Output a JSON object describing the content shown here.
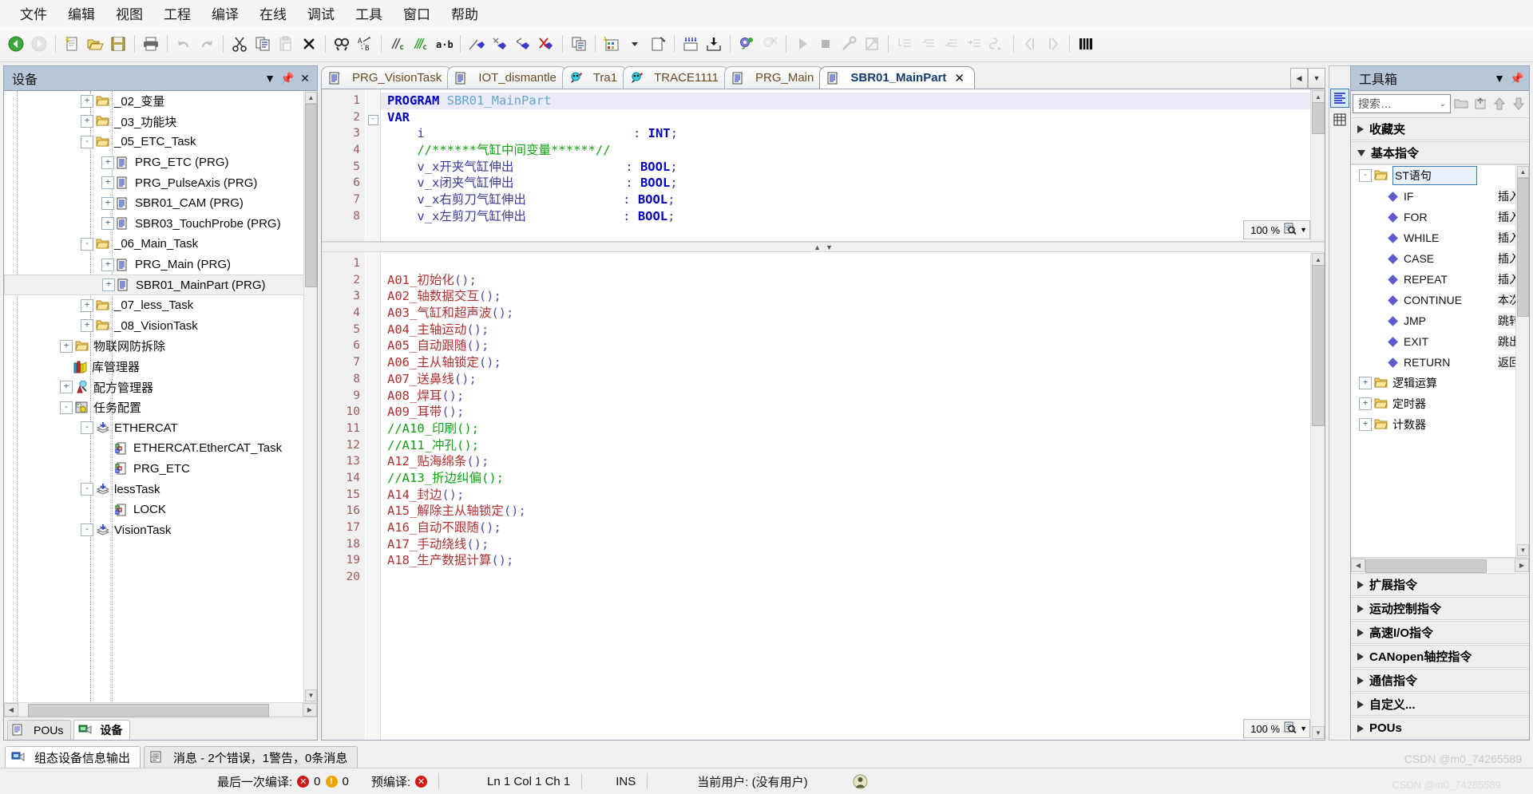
{
  "menu": {
    "items": [
      "文件",
      "编辑",
      "视图",
      "工程",
      "编译",
      "在线",
      "调试",
      "工具",
      "窗口",
      "帮助"
    ]
  },
  "toolbar": {
    "icons": [
      "back-icon",
      "forward-icon",
      "sep",
      "new-file-icon",
      "open-folder-icon",
      "save-icon",
      "sep",
      "print-icon",
      "sep",
      "undo-icon",
      "redo-icon",
      "sep",
      "cut-icon",
      "copy-icon",
      "paste-icon",
      "delete-icon",
      "sep",
      "find-icon",
      "replace-icon",
      "sep",
      "compile-icon",
      "rebuild-icon",
      "a-b-icon",
      "sep",
      "login-icon",
      "download-icon",
      "upload-icon",
      "logout-icon",
      "sep",
      "copy-all-icon",
      "sep",
      "visualization-icon",
      "dropdown-icon",
      "new-window-icon",
      "sep",
      "write-values-icon",
      "force-values-icon",
      "sep",
      "start-debug-icon",
      "stop-debug-icon",
      "sep",
      "run-icon",
      "stop-icon",
      "wrench-icon",
      "edit-mode-icon",
      "sep",
      "indent1-icon",
      "indent2-icon",
      "indent3-icon",
      "indent4-icon",
      "jump-icon",
      "sep",
      "prev-icon",
      "next-icon",
      "sep",
      "grid-icon"
    ]
  },
  "devices": {
    "title": "设备",
    "caption_buttons": [
      "chevron-down-icon",
      "pin-icon",
      "close-icon"
    ],
    "tree": [
      {
        "label": "_02_变量",
        "indent": 3,
        "expander": "+",
        "icon": "folder-icon",
        "selected": false
      },
      {
        "label": "_03_功能块",
        "indent": 3,
        "expander": "+",
        "icon": "folder-icon",
        "selected": false
      },
      {
        "label": "_05_ETC_Task",
        "indent": 3,
        "expander": "-",
        "icon": "folder-icon",
        "selected": false
      },
      {
        "label": "PRG_ETC (PRG)",
        "indent": 4,
        "expander": "+",
        "icon": "pou-icon",
        "selected": false
      },
      {
        "label": "PRG_PulseAxis (PRG)",
        "indent": 4,
        "expander": "+",
        "icon": "pou-icon",
        "selected": false
      },
      {
        "label": "SBR01_CAM (PRG)",
        "indent": 4,
        "expander": "+",
        "icon": "pou-icon",
        "selected": false
      },
      {
        "label": "SBR03_TouchProbe (PRG)",
        "indent": 4,
        "expander": "+",
        "icon": "pou-icon",
        "selected": false
      },
      {
        "label": "_06_Main_Task",
        "indent": 3,
        "expander": "-",
        "icon": "folder-icon",
        "selected": false
      },
      {
        "label": "PRG_Main (PRG)",
        "indent": 4,
        "expander": "+",
        "icon": "pou-icon",
        "selected": false
      },
      {
        "label": "SBR01_MainPart (PRG)",
        "indent": 4,
        "expander": "+",
        "icon": "pou-icon",
        "selected": true
      },
      {
        "label": "_07_less_Task",
        "indent": 3,
        "expander": "+",
        "icon": "folder-icon",
        "selected": false
      },
      {
        "label": "_08_VisionTask",
        "indent": 3,
        "expander": "+",
        "icon": "folder-icon",
        "selected": false
      },
      {
        "label": "物联网防拆除",
        "indent": 2,
        "expander": "+",
        "icon": "folder-icon",
        "selected": false
      },
      {
        "label": "库管理器",
        "indent": 2,
        "expander": "",
        "icon": "library-icon",
        "selected": false
      },
      {
        "label": "配方管理器",
        "indent": 2,
        "expander": "+",
        "icon": "recipe-icon",
        "selected": false
      },
      {
        "label": "任务配置",
        "indent": 2,
        "expander": "-",
        "icon": "taskconfig-icon",
        "selected": false
      },
      {
        "label": "ETHERCAT",
        "indent": 3,
        "expander": "-",
        "icon": "task-icon",
        "selected": false
      },
      {
        "label": "ETHERCAT.EtherCAT_Task",
        "indent": 4,
        "expander": "",
        "icon": "taskcall-icon",
        "selected": false
      },
      {
        "label": "PRG_ETC",
        "indent": 4,
        "expander": "",
        "icon": "taskcall-icon",
        "selected": false
      },
      {
        "label": "lessTask",
        "indent": 3,
        "expander": "-",
        "icon": "task-icon",
        "selected": false
      },
      {
        "label": "LOCK",
        "indent": 4,
        "expander": "",
        "icon": "taskcall-icon",
        "selected": false
      },
      {
        "label": "VisionTask",
        "indent": 3,
        "expander": "-",
        "icon": "task-icon",
        "selected": false
      }
    ],
    "bottom_tabs": [
      {
        "label": "POUs",
        "icon": "pous-icon",
        "active": false
      },
      {
        "label": "设备",
        "icon": "devices-icon",
        "active": true
      }
    ]
  },
  "editor": {
    "tabs": [
      {
        "label": "PRG_VisionTask",
        "icon": "pou-icon",
        "active": false,
        "closable": false
      },
      {
        "label": "IOT_dismantle",
        "icon": "pou-icon",
        "active": false,
        "closable": false
      },
      {
        "label": "Tra1",
        "icon": "trace-icon",
        "active": false,
        "closable": false
      },
      {
        "label": "TRACE1111",
        "icon": "trace-icon",
        "active": false,
        "closable": false
      },
      {
        "label": "PRG_Main",
        "icon": "pou-icon",
        "active": false,
        "closable": false
      },
      {
        "label": "SBR01_MainPart",
        "icon": "pou-icon",
        "active": true,
        "closable": true
      }
    ],
    "tab_nav": [
      "chevron-left-icon",
      "chevron-down-icon"
    ],
    "declaration": {
      "zoom": "100 %",
      "lines": [
        {
          "n": 1,
          "fold": "",
          "current": true,
          "segs": [
            {
              "t": "PROGRAM ",
              "c": "kw"
            },
            {
              "t": "SBR01_MainPart",
              "c": "idn"
            }
          ]
        },
        {
          "n": 2,
          "fold": "-",
          "current": false,
          "segs": [
            {
              "t": "VAR",
              "c": "kw"
            }
          ]
        },
        {
          "n": 3,
          "fold": "",
          "current": false,
          "segs": [
            {
              "t": "    i                            : ",
              "c": "var"
            },
            {
              "t": "INT",
              "c": "typ"
            },
            {
              "t": ";",
              "c": "var"
            }
          ]
        },
        {
          "n": 4,
          "fold": "",
          "current": false,
          "segs": [
            {
              "t": "    //******气缸中间变量******//",
              "c": "cmt"
            }
          ]
        },
        {
          "n": 5,
          "fold": "",
          "current": false,
          "segs": [
            {
              "t": "    v_x开夹气缸伸出               : ",
              "c": "var"
            },
            {
              "t": "BOOL",
              "c": "typ"
            },
            {
              "t": ";",
              "c": "var"
            }
          ]
        },
        {
          "n": 6,
          "fold": "",
          "current": false,
          "segs": [
            {
              "t": "    v_x闭夹气缸伸出               : ",
              "c": "var"
            },
            {
              "t": "BOOL",
              "c": "typ"
            },
            {
              "t": ";",
              "c": "var"
            }
          ]
        },
        {
          "n": 7,
          "fold": "",
          "current": false,
          "segs": [
            {
              "t": "    v_x右剪刀气缸伸出             : ",
              "c": "var"
            },
            {
              "t": "BOOL",
              "c": "typ"
            },
            {
              "t": ";",
              "c": "var"
            }
          ]
        },
        {
          "n": 8,
          "fold": "",
          "current": false,
          "segs": [
            {
              "t": "    v_x左剪刀气缸伸出             : ",
              "c": "var"
            },
            {
              "t": "BOOL",
              "c": "typ"
            },
            {
              "t": ";",
              "c": "var"
            }
          ]
        }
      ]
    },
    "implementation": {
      "zoom": "100 %",
      "lines": [
        {
          "n": 1,
          "segs": []
        },
        {
          "n": 2,
          "segs": [
            {
              "t": "A01_初始化",
              "c": "fn"
            },
            {
              "t": "();",
              "c": "pn"
            }
          ]
        },
        {
          "n": 3,
          "segs": [
            {
              "t": "A02_轴数据交互",
              "c": "fn"
            },
            {
              "t": "();",
              "c": "pn"
            }
          ]
        },
        {
          "n": 4,
          "segs": [
            {
              "t": "A03_气缸和超声波",
              "c": "fn"
            },
            {
              "t": "();",
              "c": "pn"
            }
          ]
        },
        {
          "n": 5,
          "segs": [
            {
              "t": "A04_主轴运动",
              "c": "fn"
            },
            {
              "t": "();",
              "c": "pn"
            }
          ]
        },
        {
          "n": 6,
          "segs": [
            {
              "t": "A05_自动跟随",
              "c": "fn"
            },
            {
              "t": "();",
              "c": "pn"
            }
          ]
        },
        {
          "n": 7,
          "segs": [
            {
              "t": "A06_主从轴锁定",
              "c": "fn"
            },
            {
              "t": "();",
              "c": "pn"
            }
          ]
        },
        {
          "n": 8,
          "segs": [
            {
              "t": "A07_送鼻线",
              "c": "fn"
            },
            {
              "t": "();",
              "c": "pn"
            }
          ]
        },
        {
          "n": 9,
          "segs": [
            {
              "t": "A08_焊耳",
              "c": "fn"
            },
            {
              "t": "();",
              "c": "pn"
            }
          ]
        },
        {
          "n": 10,
          "segs": [
            {
              "t": "A09_耳带",
              "c": "fn"
            },
            {
              "t": "();",
              "c": "pn"
            }
          ]
        },
        {
          "n": 11,
          "segs": [
            {
              "t": "//A10_印刷();",
              "c": "cmt"
            }
          ]
        },
        {
          "n": 12,
          "segs": [
            {
              "t": "//A11_冲孔();",
              "c": "cmt"
            }
          ]
        },
        {
          "n": 13,
          "segs": [
            {
              "t": "A12_贴海绵条",
              "c": "fn"
            },
            {
              "t": "();",
              "c": "pn"
            }
          ]
        },
        {
          "n": 14,
          "segs": [
            {
              "t": "//A13_折边纠偏();",
              "c": "cmt"
            }
          ]
        },
        {
          "n": 15,
          "segs": [
            {
              "t": "A14_封边",
              "c": "fn"
            },
            {
              "t": "();",
              "c": "pn"
            }
          ]
        },
        {
          "n": 16,
          "segs": [
            {
              "t": "A15_解除主从轴锁定",
              "c": "fn"
            },
            {
              "t": "();",
              "c": "pn"
            }
          ]
        },
        {
          "n": 17,
          "segs": [
            {
              "t": "A16_自动不跟随",
              "c": "fn"
            },
            {
              "t": "();",
              "c": "pn"
            }
          ]
        },
        {
          "n": 18,
          "segs": [
            {
              "t": "A17_手动绕线",
              "c": "fn"
            },
            {
              "t": "();",
              "c": "pn"
            }
          ]
        },
        {
          "n": 19,
          "segs": [
            {
              "t": "A18_生产数据计算",
              "c": "fn"
            },
            {
              "t": "();",
              "c": "pn"
            }
          ]
        },
        {
          "n": 20,
          "segs": []
        }
      ]
    }
  },
  "toolbox": {
    "title": "工具箱",
    "caption_buttons": [
      "chevron-down-icon",
      "pin-icon"
    ],
    "search": {
      "value": "",
      "placeholder": "搜索…"
    },
    "search_buttons": [
      "folder-icon",
      "new-category-icon",
      "move-up-icon",
      "move-down-icon"
    ],
    "side_icons": [
      "toolbox-icon",
      "properties-icon"
    ],
    "groups": [
      {
        "label": "收藏夹",
        "open": false
      },
      {
        "label": "基本指令",
        "open": true
      }
    ],
    "category": {
      "label": "ST语句",
      "expander": "-",
      "selected": true
    },
    "instructions": [
      {
        "name": "IF",
        "desc": "插入 IF条件语句"
      },
      {
        "name": "FOR",
        "desc": "插入 FOR循环语句"
      },
      {
        "name": "WHILE",
        "desc": "插入 WHILE循环语句"
      },
      {
        "name": "CASE",
        "desc": "插入 CASE选择语句"
      },
      {
        "name": "REPEAT",
        "desc": "插入 REPEAT循环语句"
      },
      {
        "name": "CONTINUE",
        "desc": "本次循环结束"
      },
      {
        "name": "JMP",
        "desc": "跳转到标签"
      },
      {
        "name": "EXIT",
        "desc": "跳出循环"
      },
      {
        "name": "RETURN",
        "desc": "返回(退出)"
      }
    ],
    "subgroups": [
      {
        "label": "逻辑运算",
        "expander": "+"
      },
      {
        "label": "定时器",
        "expander": "+"
      },
      {
        "label": "计数器",
        "expander": "+"
      }
    ],
    "collapsed_groups": [
      "扩展指令",
      "运动控制指令",
      "高速I/O指令",
      "CANopen轴控指令",
      "通信指令",
      "自定义...",
      "POUs"
    ]
  },
  "bottom": {
    "tabs": [
      {
        "label": "组态设备信息输出",
        "icon": "device-output-icon",
        "active": true
      },
      {
        "label": "消息 - 2个错误，1警告，0条消息",
        "icon": "messages-icon",
        "active": false
      }
    ]
  },
  "status": {
    "last_build_label": "最后一次编译:",
    "errors": "0",
    "warnings": "0",
    "precompile_label": "预编译:",
    "precompile_state": "error",
    "position": "Ln 1  Col 1  Ch 1",
    "insert_mode": "INS",
    "user_label": "当前用户: (没有用户)",
    "watermark": "CSDN @m0_74265589"
  },
  "colors": {
    "panel_caption": "#b8c6d9",
    "accent": "#3b78c3",
    "keyword": "#0000c0",
    "comment": "#12a012",
    "function": "#b03030",
    "error": "#d01818",
    "warning": "#e8a400"
  }
}
